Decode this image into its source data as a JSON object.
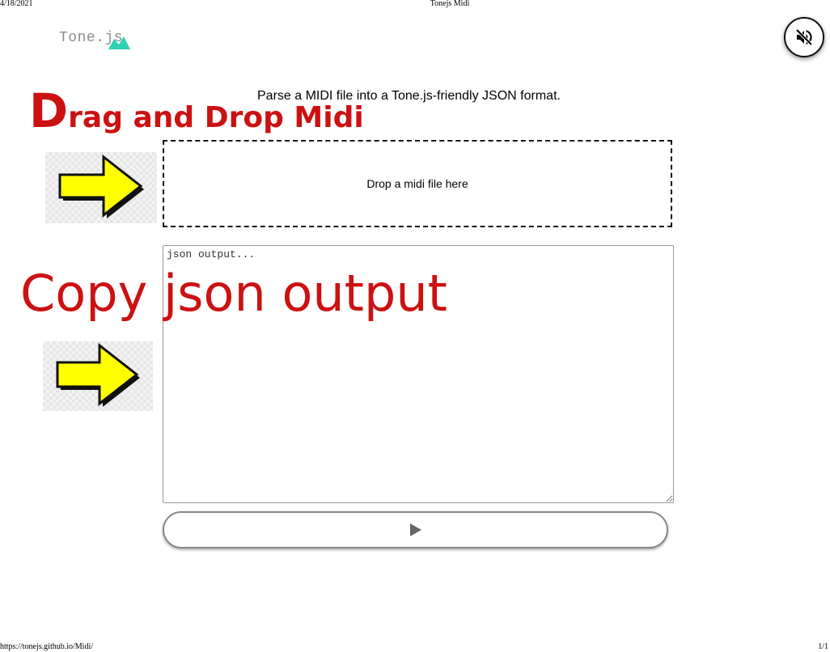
{
  "print": {
    "date": "4/18/2021",
    "title": "Tonejs Midi",
    "url": "https://tonejs.github.io/Midi/",
    "pages": "1/1"
  },
  "logo": {
    "text": "Tone.js"
  },
  "header": {
    "subtitle": "Parse a MIDI file into a Tone.js-friendly JSON format."
  },
  "annotations": {
    "drag_first": "D",
    "drag_rest": "rag and Drop Midi",
    "copy": "Copy json output"
  },
  "dropzone": {
    "label": "Drop a midi file here"
  },
  "output": {
    "placeholder": "json output..."
  },
  "controls": {
    "mute_icon": "muted-speaker-icon",
    "play_icon": "play-icon"
  },
  "colors": {
    "annotation_red": "#cc1111",
    "arrow_yellow": "#ffff00",
    "logo_teal": "#2ed1b5"
  }
}
